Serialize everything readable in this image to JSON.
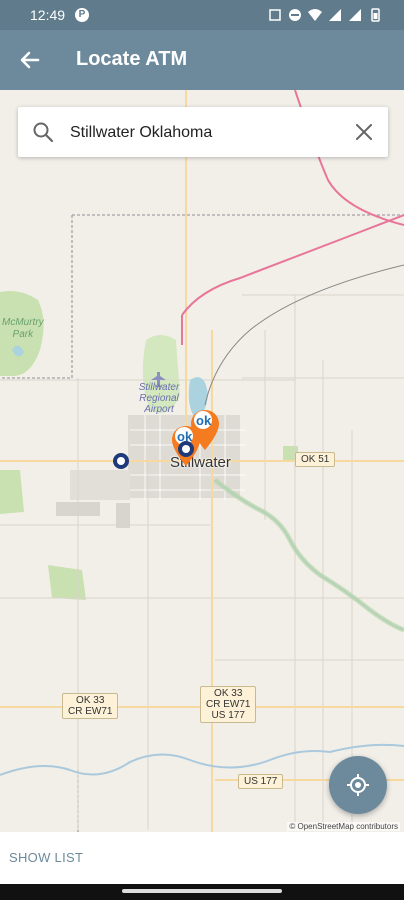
{
  "status_bar": {
    "time": "12:49",
    "app_icon": "P"
  },
  "header": {
    "title": "Locate ATM"
  },
  "search": {
    "value": "Stillwater Oklahoma"
  },
  "map": {
    "city_label": "Stillwater",
    "park_label_1": "McMurtry",
    "park_label_2": "Park",
    "airport_label_1": "Stillwater",
    "airport_label_2": "Regional",
    "airport_label_3": "Airport",
    "shield_ok51": "OK 51",
    "shield_left_1": "OK 33",
    "shield_left_2": "CR EW71",
    "shield_right_1": "OK 33",
    "shield_right_2": "CR EW71",
    "shield_right_3": "US 177",
    "shield_us177": "US 177",
    "attribution": "© OpenStreetMap contributors"
  },
  "bottom": {
    "show_list": "SHOW LIST"
  },
  "colors": {
    "app_bar": "#6c8a9c",
    "status_bar": "#5f7b8c",
    "pin_orange": "#f47b20",
    "pin_blue": "#1f3a7a"
  }
}
